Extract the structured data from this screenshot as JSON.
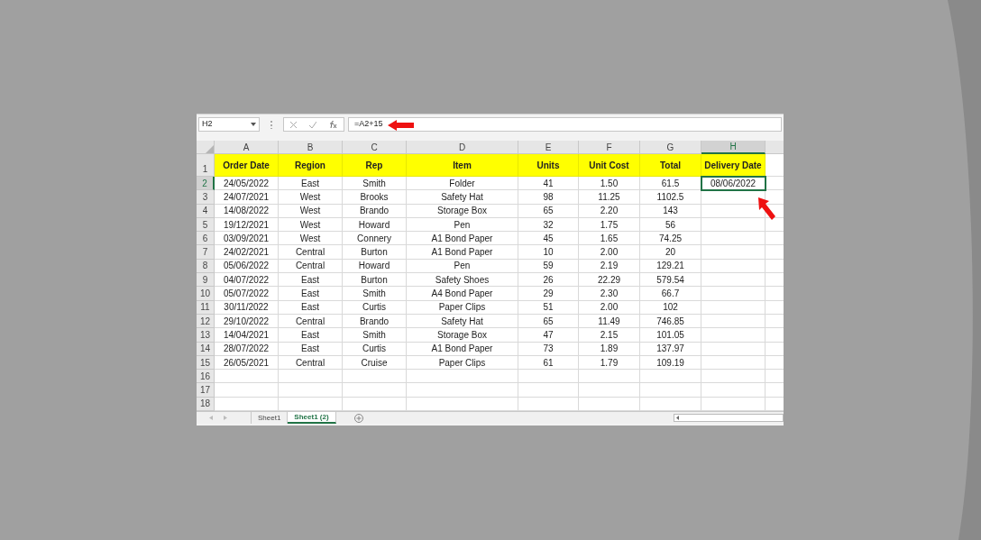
{
  "name_box": "H2",
  "formula": "=A2+15",
  "columns": [
    {
      "label": "A",
      "selected": false
    },
    {
      "label": "B",
      "selected": false
    },
    {
      "label": "C",
      "selected": false
    },
    {
      "label": "D",
      "selected": false
    },
    {
      "label": "E",
      "selected": false
    },
    {
      "label": "F",
      "selected": false
    },
    {
      "label": "G",
      "selected": false
    },
    {
      "label": "H",
      "selected": true
    }
  ],
  "header_row": {
    "number": "1",
    "cells": [
      "Order Date",
      "Region",
      "Rep",
      "Item",
      "Units",
      "Unit Cost",
      "Total",
      "Delivery Date"
    ]
  },
  "rows": [
    {
      "number": "2",
      "selected": true,
      "cells": [
        "24/05/2022",
        "East",
        "Smith",
        "Folder",
        "41",
        "1.50",
        "61.5",
        "08/06/2022"
      ]
    },
    {
      "number": "3",
      "selected": false,
      "cells": [
        "24/07/2021",
        "West",
        "Brooks",
        "Safety Hat",
        "98",
        "11.25",
        "1102.5"
      ]
    },
    {
      "number": "4",
      "selected": false,
      "cells": [
        "14/08/2022",
        "West",
        "Brando",
        "Storage Box",
        "65",
        "2.20",
        "143"
      ]
    },
    {
      "number": "5",
      "selected": false,
      "cells": [
        "19/12/2021",
        "West",
        "Howard",
        "Pen",
        "32",
        "1.75",
        "56"
      ]
    },
    {
      "number": "6",
      "selected": false,
      "cells": [
        "03/09/2021",
        "West",
        "Connery",
        "A1 Bond Paper",
        "45",
        "1.65",
        "74.25"
      ]
    },
    {
      "number": "7",
      "selected": false,
      "cells": [
        "24/02/2021",
        "Central",
        "Burton",
        "A1 Bond Paper",
        "10",
        "2.00",
        "20"
      ]
    },
    {
      "number": "8",
      "selected": false,
      "cells": [
        "05/06/2022",
        "Central",
        "Howard",
        "Pen",
        "59",
        "2.19",
        "129.21"
      ]
    },
    {
      "number": "9",
      "selected": false,
      "cells": [
        "04/07/2022",
        "East",
        "Burton",
        "Safety Shoes",
        "26",
        "22.29",
        "579.54"
      ]
    },
    {
      "number": "10",
      "selected": false,
      "cells": [
        "05/07/2022",
        "East",
        "Smith",
        "A4 Bond Paper",
        "29",
        "2.30",
        "66.7"
      ]
    },
    {
      "number": "11",
      "selected": false,
      "cells": [
        "30/11/2022",
        "East",
        "Curtis",
        "Paper Clips",
        "51",
        "2.00",
        "102"
      ]
    },
    {
      "number": "12",
      "selected": false,
      "cells": [
        "29/10/2022",
        "Central",
        "Brando",
        "Safety Hat",
        "65",
        "11.49",
        "746.85"
      ]
    },
    {
      "number": "13",
      "selected": false,
      "cells": [
        "14/04/2021",
        "East",
        "Smith",
        "Storage Box",
        "47",
        "2.15",
        "101.05"
      ]
    },
    {
      "number": "14",
      "selected": false,
      "cells": [
        "28/07/2022",
        "East",
        "Curtis",
        "A1 Bond Paper",
        "73",
        "1.89",
        "137.97"
      ]
    },
    {
      "number": "15",
      "selected": false,
      "cells": [
        "26/05/2021",
        "Central",
        "Cruise",
        "Paper Clips",
        "61",
        "1.79",
        "109.19"
      ]
    },
    {
      "number": "16",
      "selected": false
    },
    {
      "number": "17",
      "selected": false
    },
    {
      "number": "18",
      "selected": false
    }
  ],
  "sheet_tabs": [
    {
      "label": "Sheet1",
      "selected": false
    },
    {
      "label": "Sheet1 (2)",
      "selected": true
    }
  ]
}
